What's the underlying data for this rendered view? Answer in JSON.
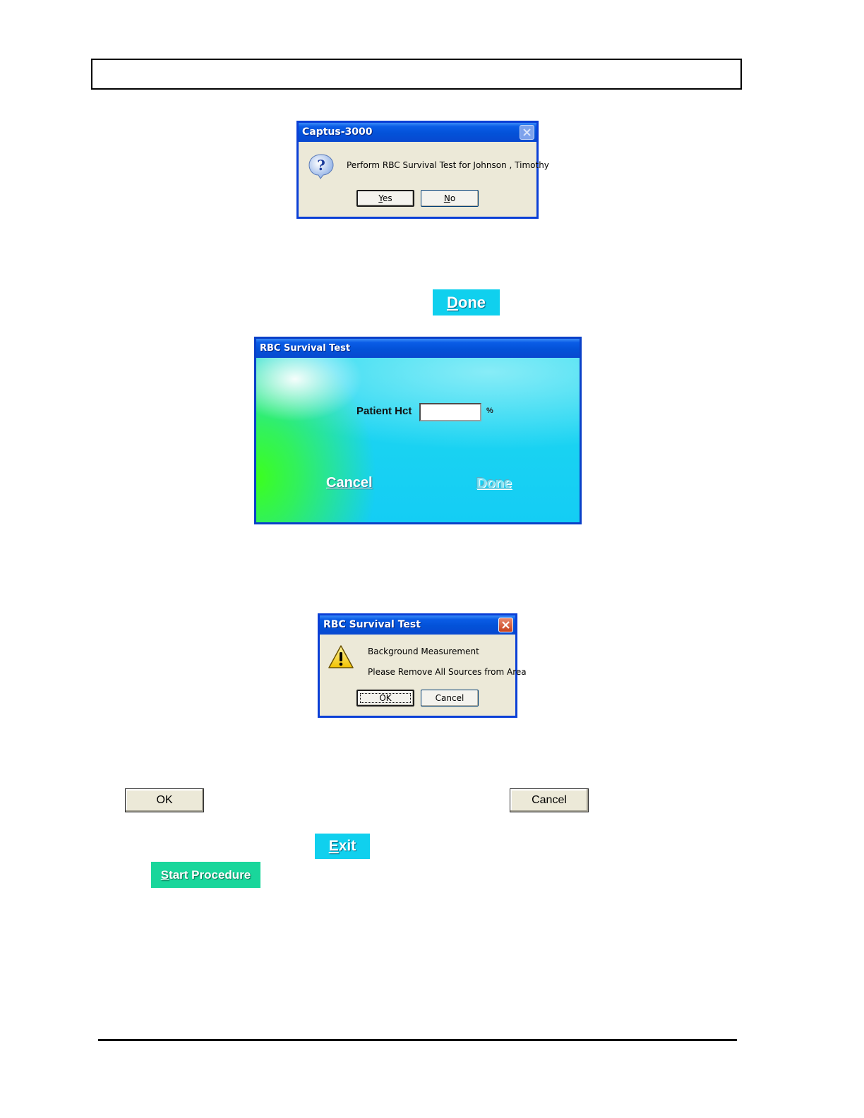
{
  "dialog1": {
    "title": "Captus-3000",
    "message": "Perform RBC Survival Test for Johnson , Timothy",
    "yes_prefix": "Y",
    "yes_rest": "es",
    "no_prefix": "N",
    "no_rest": "o"
  },
  "done_button": {
    "prefix": "D",
    "rest": "one"
  },
  "dialog2": {
    "title": "RBC Survival Test",
    "hct_label": "Patient Hct",
    "hct_value": "",
    "unit": "%",
    "cancel_label": "Cancel",
    "done_label": "Done"
  },
  "dialog3": {
    "title": "RBC Survival Test",
    "line1": "Background Measurement",
    "line2": "Please Remove All Sources from Area",
    "ok_label": "OK",
    "cancel_label": "Cancel"
  },
  "standalone": {
    "ok_label": "OK",
    "cancel_label": "Cancel",
    "exit_prefix": "E",
    "exit_rest": "xit",
    "start_prefix": "S",
    "start_rest": "tart Procedure"
  },
  "colors": {
    "xp_title_blue": "#0352d8",
    "dialog_bg": "#ece9d8",
    "aqua_button": "#0fd3f2",
    "green_button": "#19d69b"
  }
}
